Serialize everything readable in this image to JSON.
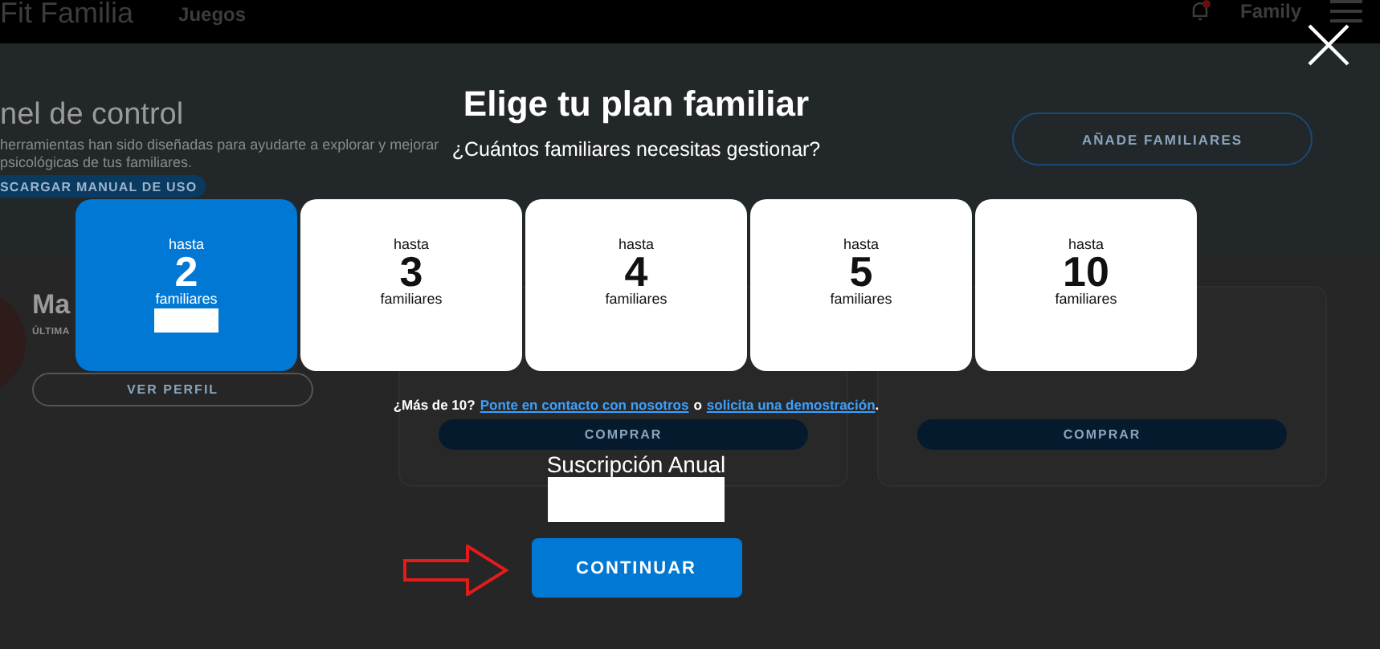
{
  "top_bar": {
    "logo": "Fit Familia",
    "nav": [
      "Juegos"
    ],
    "notification_dot": true,
    "account": "Family"
  },
  "background": {
    "heading": "nel de control",
    "description_lines": [
      "herramientas han sido diseñadas para ayudarte a explorar y mejorar",
      "psicológicas de tus familiares."
    ],
    "manual_button": "SCARGAR MANUAL DE USO",
    "add_button": "AÑADE FAMILIARES",
    "profile": {
      "name": "Ma",
      "last_label": "ÚLTIMA",
      "button": "VER PERFIL"
    },
    "buy_buttons": [
      "COMPRAR",
      "COMPRAR"
    ]
  },
  "modal": {
    "title": "Elige tu plan familiar",
    "subtitle": "¿Cuántos familiares necesitas gestionar?",
    "plans": [
      {
        "prefix": "hasta",
        "count": "2",
        "unit": "familiares",
        "selected": true
      },
      {
        "prefix": "hasta",
        "count": "3",
        "unit": "familiares",
        "selected": false
      },
      {
        "prefix": "hasta",
        "count": "4",
        "unit": "familiares",
        "selected": false
      },
      {
        "prefix": "hasta",
        "count": "5",
        "unit": "familiares",
        "selected": false
      },
      {
        "prefix": "hasta",
        "count": "10",
        "unit": "familiares",
        "selected": false
      }
    ],
    "contact": {
      "lead": "¿Más de 10?",
      "link_contact": "Ponte en contacto con nosotros",
      "joiner": "o",
      "link_demo": "solicita una demostración",
      "end": "."
    },
    "subscription_label": "Suscripción Anual",
    "continue_button": "CONTINUAR"
  }
}
